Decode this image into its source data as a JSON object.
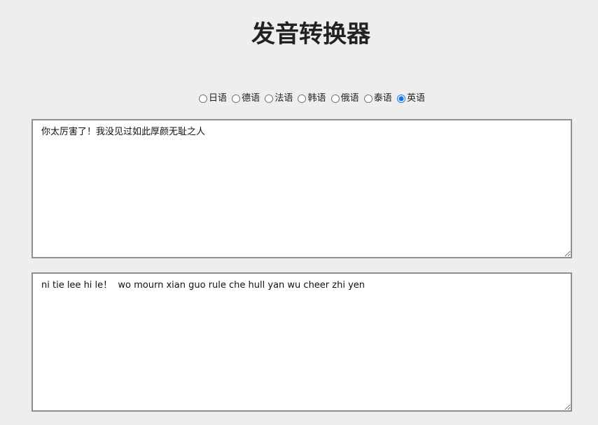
{
  "header": {
    "title": "发音转换器"
  },
  "languages": {
    "options": [
      {
        "label": "日语",
        "checked": false
      },
      {
        "label": "德语",
        "checked": false
      },
      {
        "label": "法语",
        "checked": false
      },
      {
        "label": "韩语",
        "checked": false
      },
      {
        "label": "俄语",
        "checked": false
      },
      {
        "label": "泰语",
        "checked": false
      },
      {
        "label": "英语",
        "checked": true
      }
    ],
    "selected": "英语"
  },
  "input": {
    "value": "你太厉害了！我没见过如此厚颜无耻之人"
  },
  "output": {
    "value": "ni tie lee hi le！  wo mourn xian guo rule che hull yan wu cheer zhi yen"
  },
  "colors": {
    "background": "#eeeeee",
    "accent": "#1a73e8",
    "border": "#8f8f8f"
  }
}
